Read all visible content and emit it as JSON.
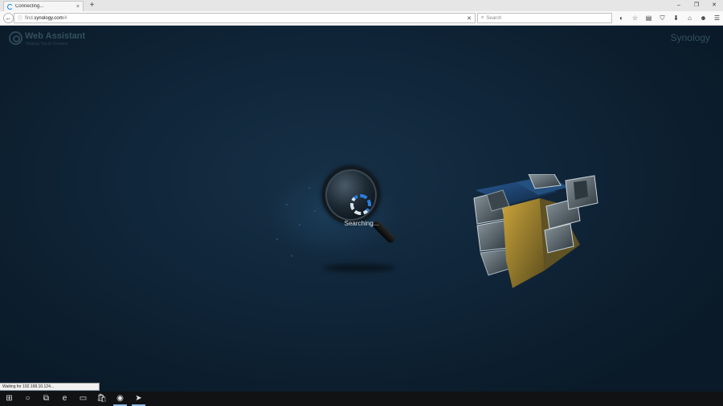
{
  "browser": {
    "tab": {
      "title": "Connecting...",
      "close_glyph": "×"
    },
    "new_tab_glyph": "+",
    "window_controls": {
      "minimize": "–",
      "restore": "❐",
      "close": "✕"
    },
    "back_glyph": "←",
    "url": {
      "info_glyph": "ⓘ",
      "prefix": "find.",
      "domain": "synology.com",
      "path": "/#",
      "stop_glyph": "✕"
    },
    "search": {
      "glyph": "⌕",
      "placeholder": "Search"
    },
    "toolbar_icons": [
      {
        "name": "sync-icon",
        "glyph": "◐"
      },
      {
        "name": "bookmark-star-icon",
        "glyph": "☆"
      },
      {
        "name": "bookmarks-list-icon",
        "glyph": "▤"
      },
      {
        "name": "pocket-icon",
        "glyph": "⛉"
      },
      {
        "name": "download-icon",
        "glyph": "⬇"
      },
      {
        "name": "home-icon",
        "glyph": "⌂"
      },
      {
        "name": "chat-icon",
        "glyph": "☻"
      },
      {
        "name": "menu-icon",
        "glyph": "☰"
      }
    ]
  },
  "page": {
    "app_title": "Web Assistant",
    "app_subtitle": "Helping You to Connect",
    "brand": "Synology",
    "status": "Searching..."
  },
  "statusbar": {
    "text": "Waiting for 192.168.10.124..."
  },
  "taskbar": {
    "items": [
      {
        "name": "start-icon",
        "glyph": "⊞",
        "active": false
      },
      {
        "name": "cortana-icon",
        "glyph": "○",
        "active": false
      },
      {
        "name": "task-view-icon",
        "glyph": "⧉",
        "active": false
      },
      {
        "name": "edge-icon",
        "glyph": "e",
        "active": false
      },
      {
        "name": "file-explorer-icon",
        "glyph": "▭",
        "active": false
      },
      {
        "name": "store-icon",
        "glyph": "🛍",
        "active": false
      },
      {
        "name": "firefox-icon",
        "glyph": "◉",
        "active": true
      },
      {
        "name": "steam-icon",
        "glyph": "➤",
        "active": true
      }
    ]
  }
}
